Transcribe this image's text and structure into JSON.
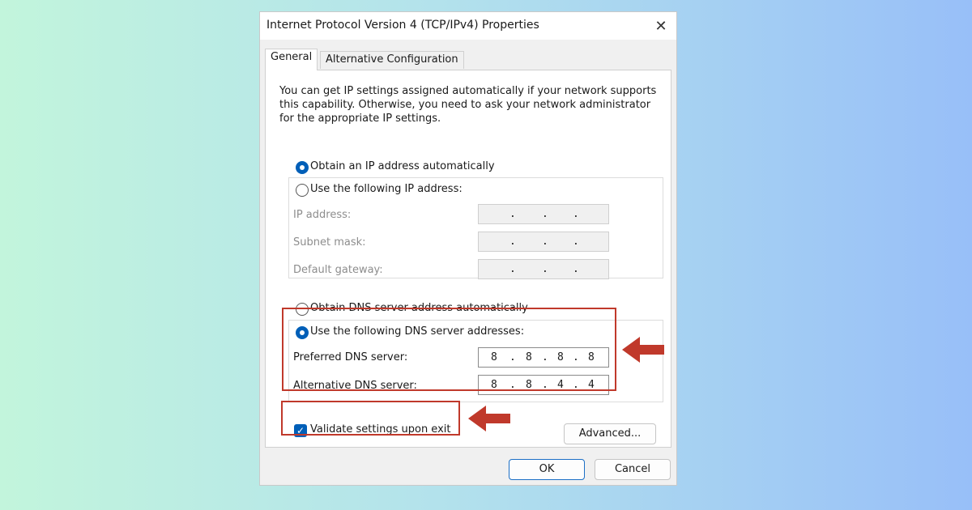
{
  "dialog": {
    "title": "Internet Protocol Version 4 (TCP/IPv4) Properties",
    "close_glyph": "✕"
  },
  "tabs": {
    "general": "General",
    "alternative": "Alternative Configuration"
  },
  "description": "You can get IP settings assigned automatically if your network supports this capability. Otherwise, you need to ask your network administrator for the appropriate IP settings.",
  "ip_section": {
    "auto_label": "Obtain an IP address automatically",
    "manual_label": "Use the following IP address:",
    "selected": "auto",
    "fields": [
      {
        "label": "IP address:",
        "octets": [
          "",
          "",
          "",
          ""
        ]
      },
      {
        "label": "Subnet mask:",
        "octets": [
          "",
          "",
          "",
          ""
        ]
      },
      {
        "label": "Default gateway:",
        "octets": [
          "",
          "",
          "",
          ""
        ]
      }
    ],
    "separator": "."
  },
  "dns_section": {
    "auto_label": "Obtain DNS server address automatically",
    "manual_label": "Use the following DNS server addresses:",
    "selected": "manual",
    "preferred": {
      "label": "Preferred DNS server:",
      "octets": [
        "8",
        "8",
        "8",
        "8"
      ]
    },
    "alternative": {
      "label": "Alternative DNS server:",
      "octets": [
        "8",
        "8",
        "4",
        "4"
      ]
    }
  },
  "validate": {
    "label": "Validate settings upon exit",
    "checked": true,
    "check_glyph": "✓"
  },
  "buttons": {
    "advanced": "Advanced...",
    "ok": "OK",
    "cancel": "Cancel"
  },
  "annotation": {
    "color": "#c0392b"
  },
  "accent_color": "#005fb8"
}
